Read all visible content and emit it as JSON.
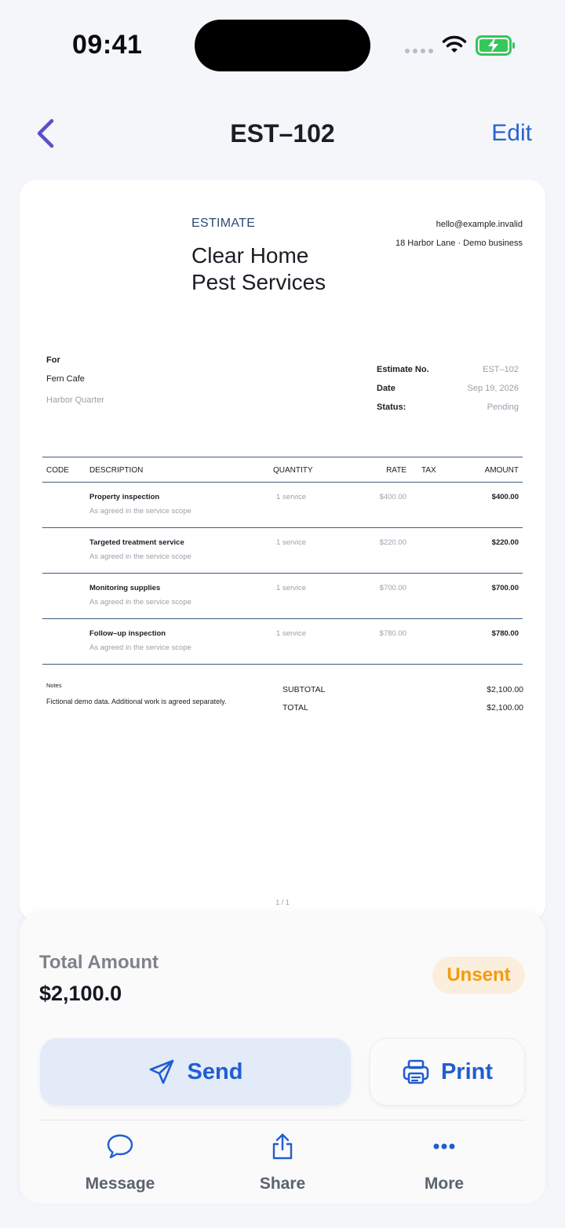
{
  "status_bar": {
    "time": "09:41"
  },
  "nav": {
    "title": "EST–102",
    "edit_label": "Edit"
  },
  "document": {
    "doc_type": "ESTIMATE",
    "company_name": "Clear Home Pest Services",
    "contact_email": "hello@example.invalid",
    "contact_address": "18 Harbor Lane · Demo business",
    "for_label": "For",
    "client_name": "Fern Cafe",
    "client_area": "Harbor Quarter",
    "meta": [
      {
        "label": "Estimate No.",
        "value": "EST–102"
      },
      {
        "label": "Date",
        "value": "Sep 19, 2026"
      },
      {
        "label": "Status:",
        "value": "Pending"
      }
    ],
    "table_headers": {
      "code": "CODE",
      "description": "DESCRIPTION",
      "quantity": "QUANTITY",
      "rate": "RATE",
      "tax": "TAX",
      "amount": "AMOUNT"
    },
    "line_items": [
      {
        "description": "Property inspection",
        "note": "As agreed in the service scope",
        "quantity": "1 service",
        "rate": "$400.00",
        "amount": "$400.00"
      },
      {
        "description": "Targeted treatment service",
        "note": "As agreed in the service scope",
        "quantity": "1 service",
        "rate": "$220.00",
        "amount": "$220.00"
      },
      {
        "description": "Monitoring supplies",
        "note": "As agreed in the service scope",
        "quantity": "1 service",
        "rate": "$700.00",
        "amount": "$700.00"
      },
      {
        "description": "Follow–up inspection",
        "note": "As agreed in the service scope",
        "quantity": "1 service",
        "rate": "$780.00",
        "amount": "$780.00"
      }
    ],
    "notes_label": "Notes",
    "notes_text": "Fictional demo data. Additional work is agreed separately.",
    "subtotal_label": "SUBTOTAL",
    "subtotal_value": "$2,100.00",
    "total_label": "TOTAL",
    "total_value": "$2,100.00",
    "page_number": "1 / 1"
  },
  "summary": {
    "total_amount_label": "Total Amount",
    "total_amount_value": "$2,100.0",
    "status_badge": "Unsent",
    "send_label": "Send",
    "print_label": "Print"
  },
  "actions": [
    {
      "label": "Message",
      "icon": "chat-bubble-icon"
    },
    {
      "label": "Share",
      "icon": "share-icon"
    },
    {
      "label": "More",
      "icon": "more-dots-icon"
    }
  ],
  "colors": {
    "accent": "#1f5ed1",
    "badge_text": "#f39b0b",
    "badge_bg": "#fbeedd",
    "battery_green": "#34c759",
    "table_rule": "#3f5a80"
  }
}
